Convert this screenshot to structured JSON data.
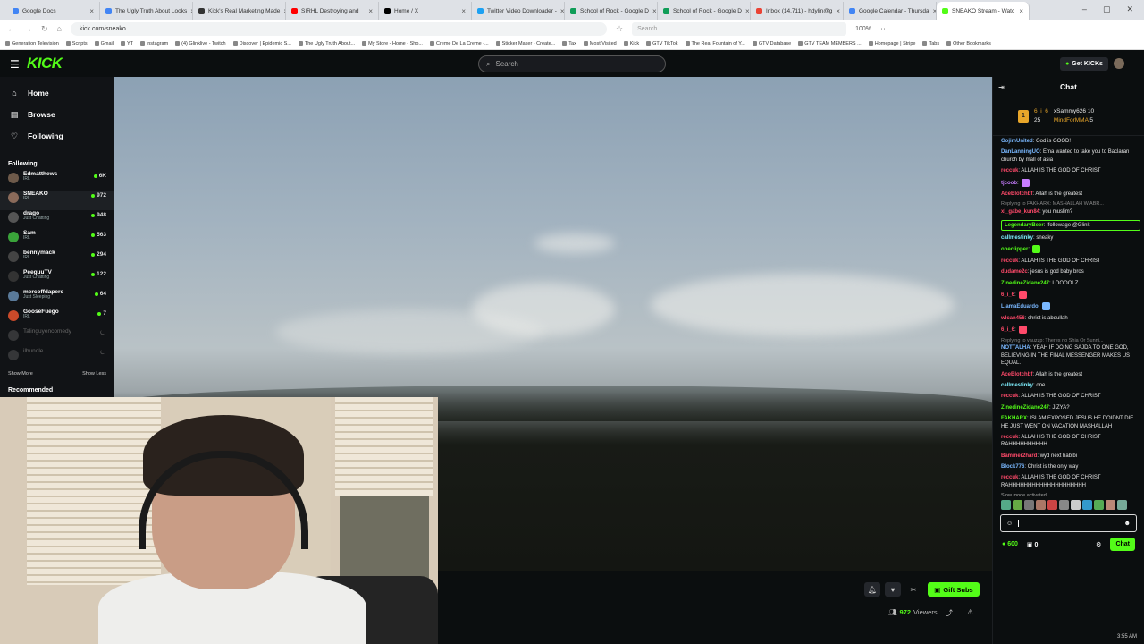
{
  "browser": {
    "tabs": [
      {
        "label": "Google Docs",
        "color": "#4285f4"
      },
      {
        "label": "The Ugly Truth About Looks",
        "color": "#4285f4"
      },
      {
        "label": "Kick's Real Marketing Made",
        "color": "#333333"
      },
      {
        "label": "SIRHL Destroying and",
        "color": "#ff0000"
      },
      {
        "label": "Home / X",
        "color": "#000000"
      },
      {
        "label": "Twitter Video Downloader -",
        "color": "#1da1f2"
      },
      {
        "label": "School of Rock - Google D",
        "color": "#0f9d58"
      },
      {
        "label": "School of Rock - Google D",
        "color": "#0f9d58"
      },
      {
        "label": "Inbox (14,711) - hdylin@g",
        "color": "#ea4335"
      },
      {
        "label": "Google Calendar - Thursda",
        "color": "#4285f4"
      },
      {
        "label": "SNEAKO Stream - Watc",
        "color": "#53fc18",
        "active": true
      }
    ],
    "url": "kick.com/sneako",
    "search_placeholder": "Search",
    "zoom": "100%",
    "bookmarks": [
      "Generation Television",
      "Scripts",
      "Gmail",
      "YT",
      "instagram",
      "(4) Glinklive - Twitch",
      "Discover | Epidemic S...",
      "The Ugly Truth About...",
      "My Store - Home - Sho...",
      "Creme De La Creme -...",
      "Sticker Maker - Create...",
      "Tax",
      "Most Visited",
      "Kick",
      "GTV TikTok",
      "The Real Fountain of Y...",
      "GTV Database",
      "GTV TEAM MEMBERS ...",
      "Homepage | Stripe",
      "Tabs",
      "Other Bookmarks"
    ]
  },
  "topbar": {
    "logo": "KICK",
    "search_placeholder": "Search",
    "get_kicks": "Get KICKs"
  },
  "sidebar": {
    "nav": [
      {
        "label": "Home",
        "icon": "home-icon"
      },
      {
        "label": "Browse",
        "icon": "browse-icon"
      },
      {
        "label": "Following",
        "icon": "heart-icon"
      }
    ],
    "following_title": "Following",
    "channels": [
      {
        "name": "Edmatthews",
        "category": "IRL",
        "viewers": "6K",
        "color": "#6e5a4a"
      },
      {
        "name": "SNEAKO",
        "category": "IRL",
        "viewers": "972",
        "color": "#8a6a5a",
        "active": true
      },
      {
        "name": "drago",
        "category": "Just Chatting",
        "viewers": "948",
        "color": "#555555"
      },
      {
        "name": "Sam",
        "category": "IRL",
        "viewers": "563",
        "color": "#3aa33a"
      },
      {
        "name": "bennymack",
        "category": "IRL",
        "viewers": "294",
        "color": "#444444"
      },
      {
        "name": "PeeguuTV",
        "category": "Just Chatting",
        "viewers": "122",
        "color": "#333333"
      },
      {
        "name": "mercoffdaperc",
        "category": "Just Sleeping",
        "viewers": "64",
        "color": "#5a7a9a"
      },
      {
        "name": "GooseFuego",
        "category": "IRL",
        "viewers": "7",
        "color": "#c94a2a"
      },
      {
        "name": "Talinguyencomedy",
        "category": "",
        "viewers": "",
        "color": "#777777",
        "offline": true
      },
      {
        "name": "ilbunole",
        "category": "",
        "viewers": "",
        "color": "#777777",
        "offline": true
      }
    ],
    "show_more": "Show More",
    "show_less": "Show Less",
    "recommended": "Recommended"
  },
  "player": {
    "gift_subs": "Gift Subs",
    "viewers_count": "972",
    "viewers_label": "Viewers"
  },
  "chat": {
    "title": "Chat",
    "pinned": {
      "rank": "1",
      "user1": "6_i_6",
      "count1": "25",
      "user2": "xSammy626",
      "count2": "10",
      "user3": "MindForMMA",
      "count3": "5"
    },
    "messages": [
      {
        "user": "GojimUnited",
        "color": "#7ab8ff",
        "text": ": God is GOOD!"
      },
      {
        "user": "DanLanningUO",
        "color": "#7ab8ff",
        "text": ": Ema wanted to take you to Baclaran church by mall of asia"
      },
      {
        "user": "reccuk",
        "color": "#ff4a6a",
        "text": ": ALLAH IS THE GOD OF CHRIST"
      },
      {
        "user": "tjcoob",
        "color": "#c77dff",
        "text": ":"
      },
      {
        "user": "AceBlotchbf",
        "color": "#ff4a6a",
        "text": ": Allah is the greatest"
      },
      {
        "reply": "Replying to FAKHARX: MASHALLAH W ABR... ",
        "user": "xl_gabe_kun84",
        "color": "#ff4a6a",
        "text": ": you muslim?"
      },
      {
        "user": "LegendaryBeer",
        "color": "#53fc18",
        "text": ": !followage @Glink",
        "highlight": true
      },
      {
        "user": "callmestinky",
        "color": "#7ff0ff",
        "text": ": sneaky"
      },
      {
        "user": "oneclipper",
        "color": "#53fc18",
        "text": ":"
      },
      {
        "user": "reccuk",
        "color": "#ff4a6a",
        "text": ": ALLAH IS THE GOD OF CHRIST"
      },
      {
        "user": "dudame2c",
        "color": "#ff4a6a",
        "text": ": jesus is god baby bros"
      },
      {
        "user": "ZinedineZidane247",
        "color": "#53fc18",
        "text": ": LOOOOLZ"
      },
      {
        "user": "6_i_6",
        "color": "#ff4a6a",
        "text": ":"
      },
      {
        "user": "LlamaEduardo",
        "color": "#7ab8ff",
        "text": ":"
      },
      {
        "user": "wlcan456",
        "color": "#ff4a6a",
        "text": ": christ is abdullah"
      },
      {
        "user": "6_i_6",
        "color": "#ff4a6a",
        "text": ":"
      },
      {
        "reply": "Replying to vauzzp: Theres no Shia Or Sunni...",
        "user": "NOTTALHA",
        "color": "#7ab8ff",
        "text": ": YEAH IF DOING SAJDA TO ONE GOD, BELIEVING IN THE FINAL MESSENGER MAKES US EQUAL."
      },
      {
        "user": "AceBlotchbf",
        "color": "#ff4a6a",
        "text": ": Allah is the greatest"
      },
      {
        "user": "callmestinky",
        "color": "#7ff0ff",
        "text": ": one"
      },
      {
        "user": "reccuk",
        "color": "#ff4a6a",
        "text": ": ALLAH IS THE GOD OF CHRIST"
      },
      {
        "user": "ZinedineZidane247",
        "color": "#53fc18",
        "text": ": JIZYA?"
      },
      {
        "user": "FAKHARX",
        "color": "#53fc18",
        "text": ": ISLAM EXPOSED JESUS HE DOIDNT DIE HE JUST WENT ON VACATION MASHALLAH"
      },
      {
        "user": "reccuk",
        "color": "#ff4a6a",
        "text": ": ALLAH IS THE GOD OF CHRIST RAHHHHHHHHHH"
      },
      {
        "user": "Bammer2hard",
        "color": "#ff4a6a",
        "text": ": wyd next habibi"
      },
      {
        "user": "Block776",
        "color": "#7ab8ff",
        "text": ": Christ is the only way"
      },
      {
        "user": "reccuk",
        "color": "#ff4a6a",
        "text": ": ALLAH IS THE GOD OF CHRIST RAHHHHHHHHHHHHHHHHHHHH"
      }
    ],
    "slow_mode": "Slow mode activated",
    "input_value": "",
    "kicks": "600",
    "gifts": "0",
    "send": "Chat"
  },
  "clock": "3:55 AM"
}
